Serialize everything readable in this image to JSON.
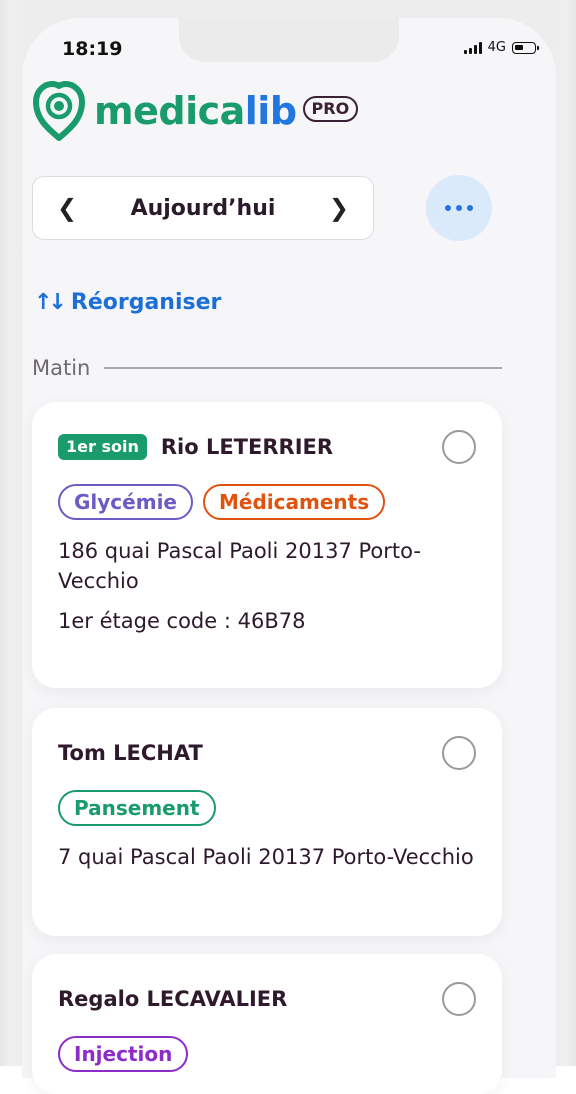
{
  "status_bar": {
    "time": "18:19",
    "network": "4G"
  },
  "brand": {
    "name_part1": "medica",
    "name_part2": "lib",
    "badge": "PRO",
    "colors": {
      "green": "#1a9b6c",
      "blue": "#2276e0"
    }
  },
  "date_nav": {
    "label": "Aujourd’hui",
    "prev_icon": "chevron-left-icon",
    "next_icon": "chevron-right-icon"
  },
  "more_button": {
    "icon": "more-horizontal-icon"
  },
  "reorganize": {
    "icon": "sort-arrows-icon",
    "label": "Réorganiser"
  },
  "section": {
    "label": "Matin"
  },
  "visits": [
    {
      "badge": "1er soin",
      "name": "Rio LETERRIER",
      "tags": [
        {
          "label": "Glycémie",
          "color": "#6b5bc4"
        },
        {
          "label": "Médicaments",
          "color": "#e0520e"
        }
      ],
      "address": "186 quai Pascal Paoli 20137 Porto-Vecchio",
      "extra": "1er étage code : 46B78"
    },
    {
      "name": "Tom LECHAT",
      "tags": [
        {
          "label": "Pansement",
          "color": "#1a9b6c"
        }
      ],
      "address": "7 quai Pascal Paoli 20137 Porto-Vecchio"
    },
    {
      "name": "Regalo LECAVALIER",
      "tags": [
        {
          "label": "Injection",
          "color": "#8e2cc9"
        }
      ]
    }
  ]
}
